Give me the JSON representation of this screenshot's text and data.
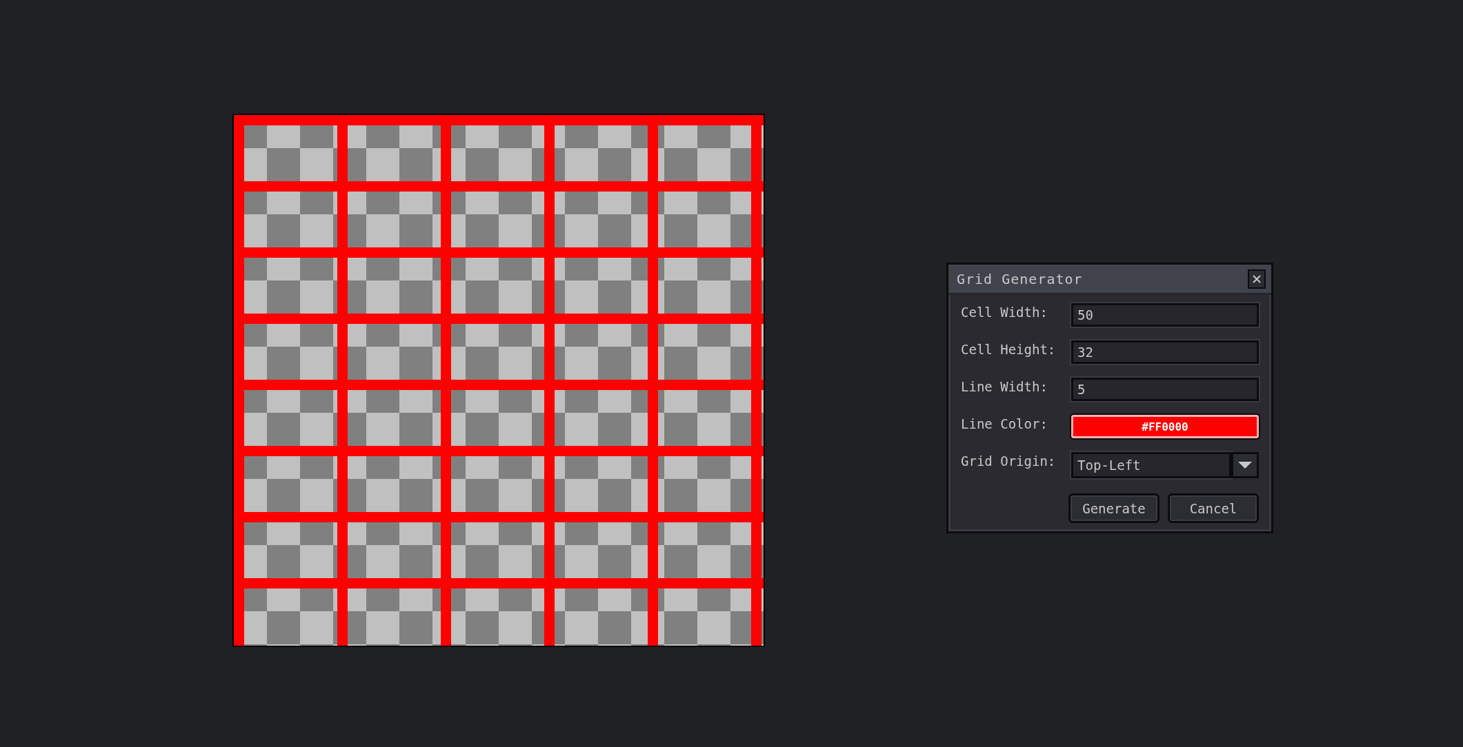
{
  "dialog": {
    "title": "Grid Generator",
    "fields": [
      {
        "kind": "number",
        "label": "Cell Width:",
        "value": "50"
      },
      {
        "kind": "number",
        "label": "Cell Height:",
        "value": "32"
      },
      {
        "kind": "number",
        "label": "Line Width:",
        "value": "5"
      },
      {
        "kind": "color",
        "label": "Line Color:",
        "value": "#FF0000",
        "color": "#ff0000"
      },
      {
        "kind": "dropdown",
        "label": "Grid Origin:",
        "value": "Top-Left"
      }
    ],
    "buttons": [
      "Generate",
      "Cancel"
    ]
  }
}
